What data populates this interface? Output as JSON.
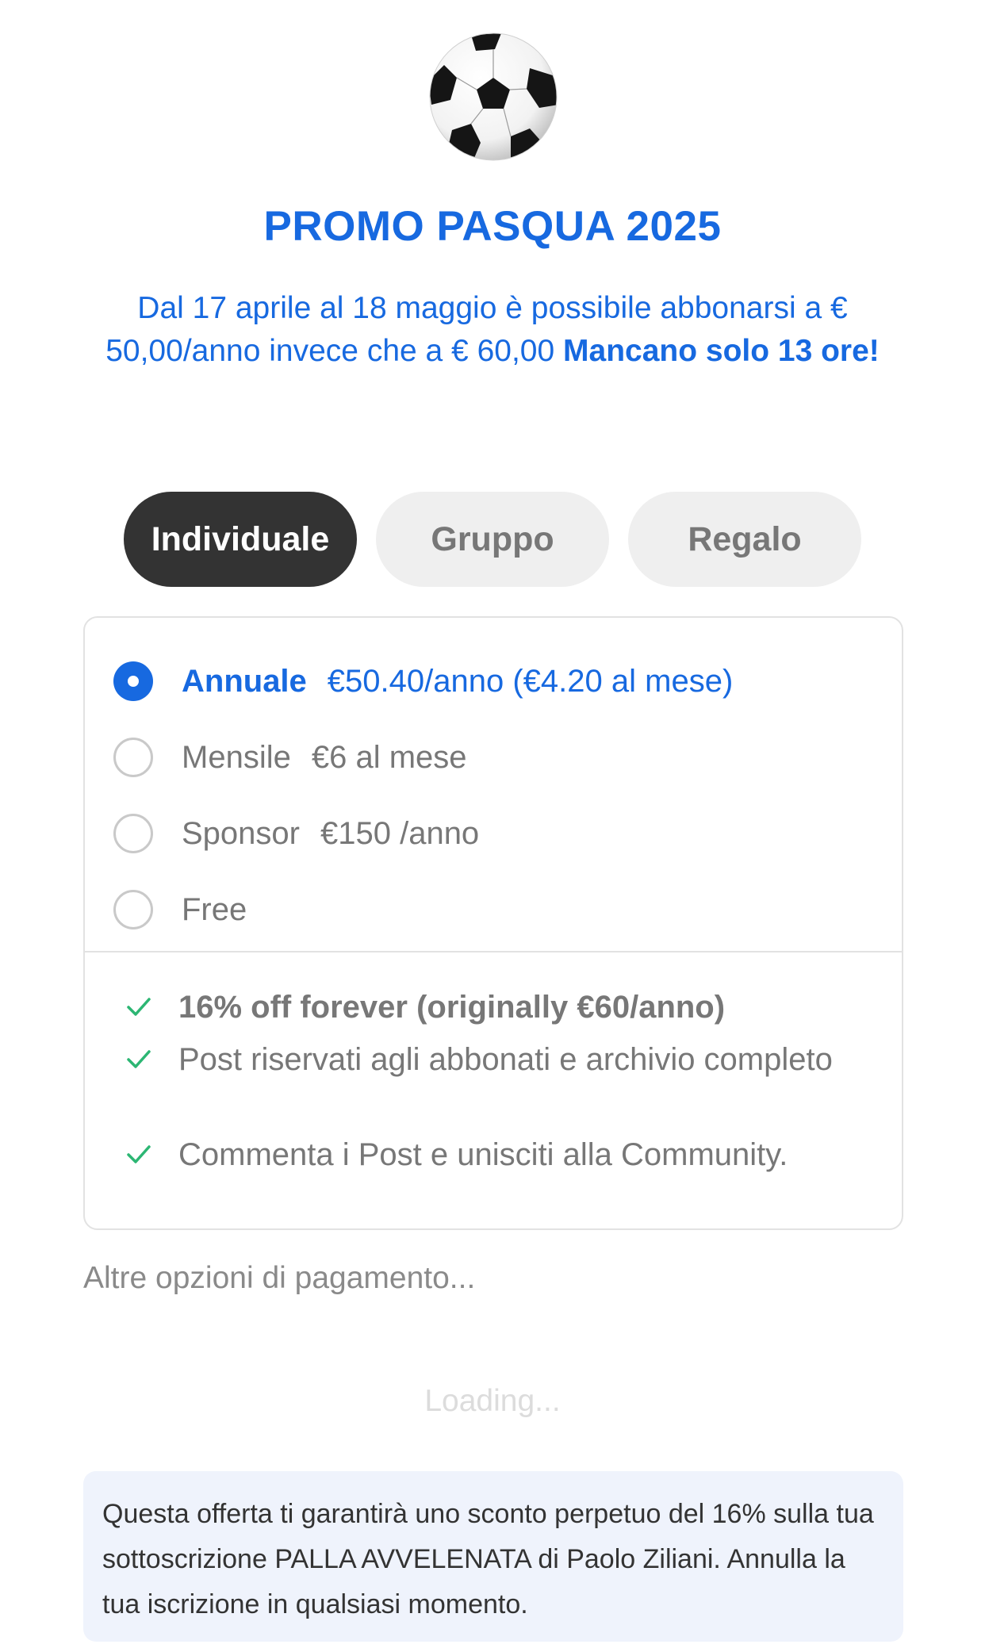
{
  "logo": {
    "icon": "soccer-ball-icon"
  },
  "promo": {
    "title": "PROMO PASQUA 2025",
    "description": "Dal 17 aprile al 18 maggio è possibile abbonarsi a € 50,00/anno invece che a € 60,00 ",
    "highlight": "Mancano solo 13 ore!"
  },
  "tabs": [
    {
      "label": "Individuale",
      "active": true
    },
    {
      "label": "Gruppo",
      "active": false
    },
    {
      "label": "Regalo",
      "active": false
    }
  ],
  "plans": [
    {
      "name": "Annuale",
      "price": "€50.40/anno (€4.20 al mese)",
      "selected": true
    },
    {
      "name": "Mensile",
      "price": "€6 al mese",
      "selected": false
    },
    {
      "name": "Sponsor",
      "price": "€150 /anno",
      "selected": false
    },
    {
      "name": "Free",
      "price": "",
      "selected": false
    }
  ],
  "features": [
    {
      "text": "16% off forever (originally €60/anno)",
      "bold": true
    },
    {
      "text": "Post riservati agli abbonati e archivio completo",
      "bold": false
    },
    {
      "text": "Commenta i Post e unisciti alla Community.",
      "bold": false
    }
  ],
  "other_payment_label": "Altre opzioni di pagamento...",
  "loading_label": "Loading...",
  "notice": "Questa offerta ti garantirà uno sconto perpetuo del 16% sulla tua sottoscrizione PALLA AVVELENATA di Paolo Ziliani. Annulla la tua iscrizione in qualsiasi momento.",
  "colors": {
    "accent": "#1769e0",
    "check": "#2cb673",
    "tab_active_bg": "#333333",
    "tab_bg": "#efefef",
    "notice_bg": "#eff3fc"
  }
}
